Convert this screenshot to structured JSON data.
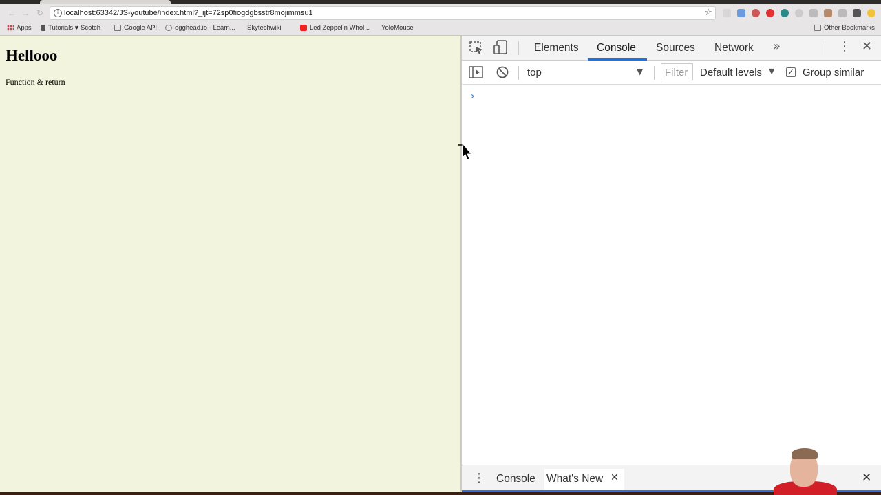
{
  "browser": {
    "url": "localhost:63342/JS-youtube/index.html?_ijt=72sp0fiogdgbsstr8mojimmsu1",
    "bookmarks": [
      {
        "label": "Apps",
        "icon": "apps-grid-icon"
      },
      {
        "label": "Tutorials ♥ Scotch",
        "icon": "scotch-icon"
      },
      {
        "label": "Google API",
        "icon": "folder-icon"
      },
      {
        "label": "egghead.io - Learn...",
        "icon": "egghead-icon"
      },
      {
        "label": "Skytechwiki",
        "icon": "page-icon"
      },
      {
        "label": "Led Zeppelin Whol...",
        "icon": "youtube-icon"
      },
      {
        "label": "YoloMouse",
        "icon": "page-icon"
      }
    ],
    "other_bookmarks": "Other Bookmarks"
  },
  "page": {
    "heading": "Hellooo",
    "text": "Function & return"
  },
  "devtools": {
    "tabs": [
      "Elements",
      "Console",
      "Sources",
      "Network"
    ],
    "active_tab": "Console",
    "console": {
      "context": "top",
      "filter_placeholder": "Filter",
      "levels": "Default levels",
      "group_similar": "Group similar",
      "group_similar_checked": true
    },
    "drawer_tabs": [
      "Console",
      "What's New"
    ],
    "drawer_active": "What's New"
  },
  "colors": {
    "page_bg": "#f3f4dd",
    "accent": "#1a73e8",
    "drawer_bar": "#3b6fd8"
  }
}
